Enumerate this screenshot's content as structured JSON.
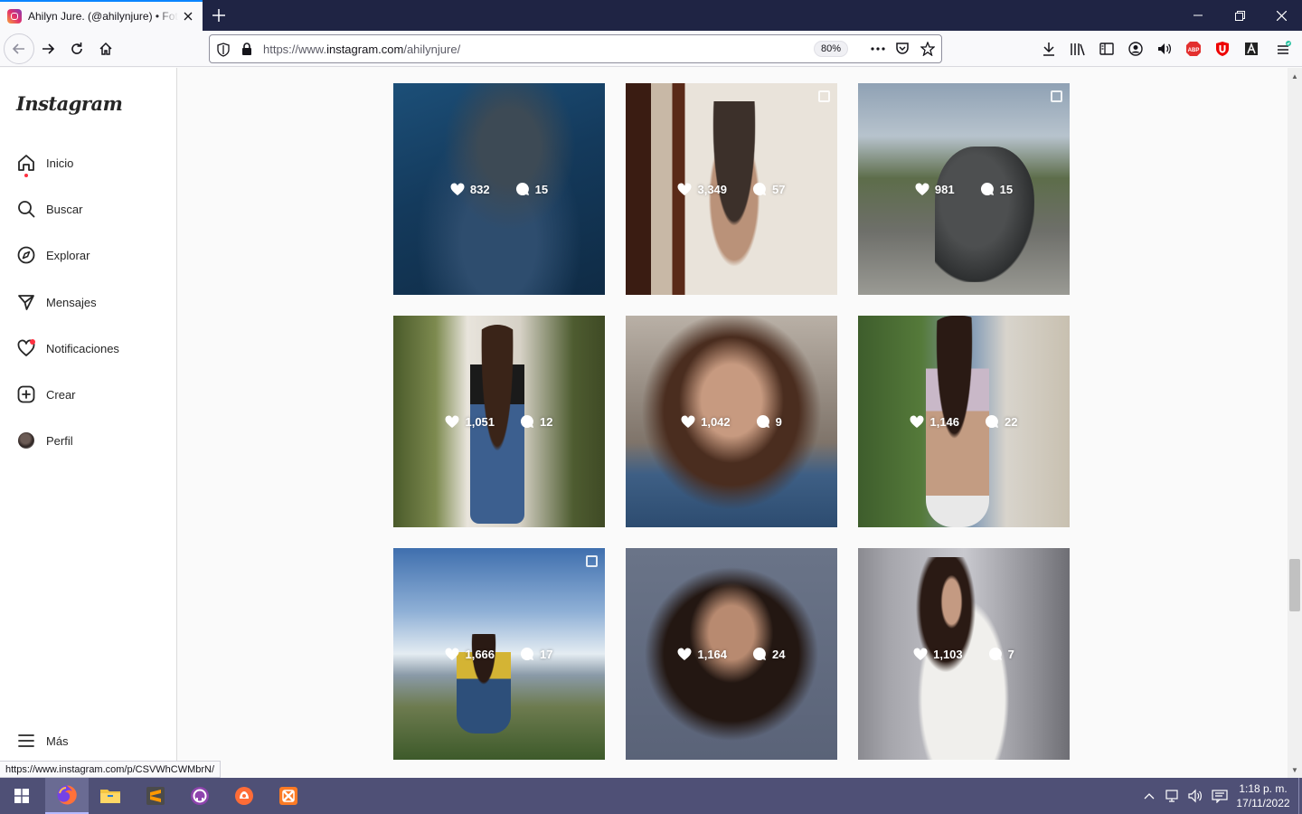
{
  "browser": {
    "tab_title": "Ahilyn Jure. (@ahilynjure) • Fotos y videos de Instagram",
    "url_prefix": "https://www.",
    "url_domain": "instagram.com",
    "url_path": "/ahilynjure/",
    "zoom": "80%",
    "status_url": "https://www.instagram.com/p/CSVWhCWMbrN/"
  },
  "sidebar": {
    "logo": "Instagram",
    "items": [
      {
        "label": "Inicio",
        "icon": "home-icon"
      },
      {
        "label": "Buscar",
        "icon": "search-icon"
      },
      {
        "label": "Explorar",
        "icon": "compass-icon"
      },
      {
        "label": "Mensajes",
        "icon": "messenger-icon"
      },
      {
        "label": "Notificaciones",
        "icon": "heart-icon"
      },
      {
        "label": "Crear",
        "icon": "plus-square-icon"
      },
      {
        "label": "Perfil",
        "icon": "avatar"
      }
    ],
    "more_label": "Más"
  },
  "posts": [
    {
      "likes": "832",
      "comments": "15",
      "multi": false
    },
    {
      "likes": "3,349",
      "comments": "57",
      "multi": true
    },
    {
      "likes": "981",
      "comments": "15",
      "multi": true
    },
    {
      "likes": "1,051",
      "comments": "12",
      "multi": false
    },
    {
      "likes": "1,042",
      "comments": "9",
      "multi": false
    },
    {
      "likes": "1,146",
      "comments": "22",
      "multi": false
    },
    {
      "likes": "1,666",
      "comments": "17",
      "multi": true
    },
    {
      "likes": "1,164",
      "comments": "24",
      "multi": false
    },
    {
      "likes": "1,103",
      "comments": "7",
      "multi": false
    }
  ],
  "taskbar": {
    "apps": [
      "windows-start-icon",
      "firefox-icon",
      "file-explorer-icon",
      "sublime-text-icon",
      "github-desktop-icon",
      "postman-icon",
      "xampp-icon"
    ],
    "time": "1:18 p. m.",
    "date": "17/11/2022"
  },
  "colors": {
    "accent": "#0a84ff",
    "titlebar": "#1f2444",
    "taskbar": "#4f5076",
    "notification_dot": "#ff3040"
  }
}
